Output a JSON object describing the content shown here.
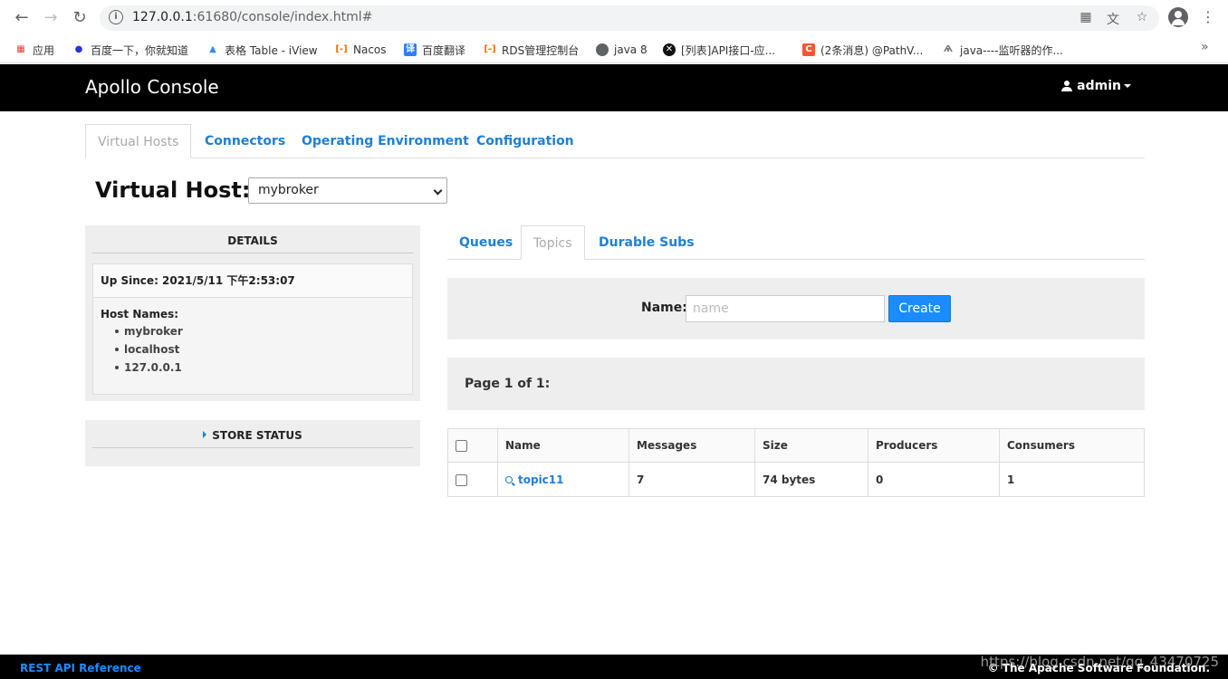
{
  "browser": {
    "url_host": "127.0.0.1",
    "url_path": ":61680/console/index.html#",
    "bookmarks": [
      {
        "label": "应用",
        "color": "#ea4335"
      },
      {
        "label": "百度一下，你就知道",
        "color": "#2932e1"
      },
      {
        "label": "表格 Table - iView",
        "color": "#2d8cf0"
      },
      {
        "label": "Nacos",
        "color": "#ff6a00"
      },
      {
        "label": "百度翻译",
        "color": "#2a7fff"
      },
      {
        "label": "RDS管理控制台",
        "color": "#ff6a00"
      },
      {
        "label": "java 8",
        "color": "#5f6368"
      },
      {
        "label": "[列表]API接口-应...",
        "color": "#111111"
      },
      {
        "label": "(2条消息) @PathV...",
        "color": "#fc5531"
      },
      {
        "label": "java----监听器的作...",
        "color": "#777777"
      }
    ],
    "more": "»"
  },
  "header": {
    "brand": "Apollo Console",
    "user": "admin"
  },
  "main_tabs": [
    {
      "label": "Virtual Hosts"
    },
    {
      "label": "Connectors"
    },
    {
      "label": "Operating Environment"
    },
    {
      "label": "Configuration"
    }
  ],
  "virtual_host": {
    "label": "Virtual Host:",
    "selected": "mybroker"
  },
  "details": {
    "title": "DETAILS",
    "up_since": "Up Since: 2021/5/11 下午2:53:07",
    "host_names_label": "Host Names:",
    "host_names": [
      "mybroker",
      "localhost",
      "127.0.0.1"
    ]
  },
  "store_status": {
    "title": "STORE STATUS"
  },
  "sub_tabs": [
    {
      "label": "Queues"
    },
    {
      "label": "Topics"
    },
    {
      "label": "Durable Subs"
    }
  ],
  "create": {
    "label": "Name:",
    "placeholder": "name",
    "button": "Create"
  },
  "pager": {
    "text": "Page 1 of 1:"
  },
  "table": {
    "headers": [
      "Name",
      "Messages",
      "Size",
      "Producers",
      "Consumers"
    ],
    "rows": [
      {
        "name": "topic11",
        "messages": "7",
        "size": "74 bytes",
        "producers": "0",
        "consumers": "1"
      }
    ]
  },
  "footer": {
    "link": "REST API Reference",
    "copyright": "© The Apache Software Foundation."
  },
  "watermark": "https://blog.csdn.net/qq_43470725"
}
